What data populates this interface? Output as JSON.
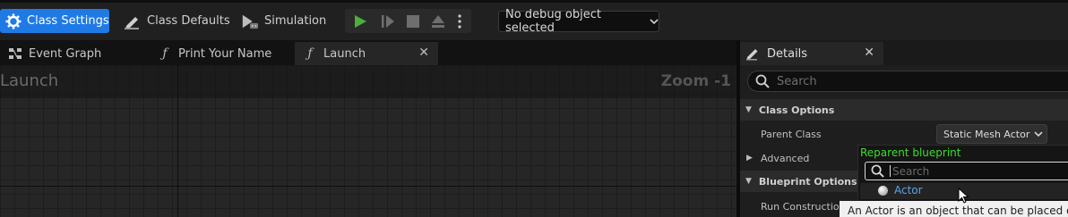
{
  "toolbar": {
    "class_settings": "Class Settings",
    "class_defaults": "Class Defaults",
    "simulation": "Simulation",
    "debug_object": "No debug object selected"
  },
  "tabs": [
    {
      "label": "Event Graph",
      "icon": "event-graph-icon"
    },
    {
      "label": "Print Your Name",
      "icon": "function-icon"
    },
    {
      "label": "Launch",
      "icon": "function-icon",
      "active": true
    }
  ],
  "graph": {
    "title": "Launch",
    "zoom": "Zoom -1"
  },
  "details": {
    "tab_label": "Details",
    "search_placeholder": "Search",
    "sections": {
      "class_options": "Class Options",
      "blueprint_options": "Blueprint Options"
    },
    "rows": {
      "parent_class_label": "Parent Class",
      "parent_class_value": "Static Mesh Actor",
      "advanced_label": "Advanced",
      "run_construction_label": "Run Construction"
    }
  },
  "popup": {
    "title": "Reparent blueprint",
    "search_placeholder": "Search",
    "item": "Actor"
  },
  "tooltip": {
    "text": "An Actor is an object that can be placed or sp"
  },
  "colors": {
    "accent_blue": "#1f7ae6",
    "play_green": "#4caf3a",
    "popup_title_green": "#3ddc2f",
    "link_blue": "#5aa3e6"
  }
}
